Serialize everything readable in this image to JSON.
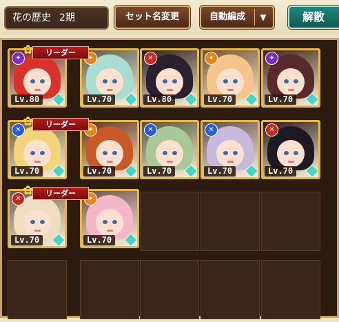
{
  "header": {
    "set_name": "花の歴史",
    "set_period": "2期",
    "rename_label": "セット名変更",
    "auto_label": "自動編成",
    "auto_arrow": "▼",
    "disband_label": "解散"
  },
  "leader_label": "リーダー",
  "rows": [
    {
      "slots": [
        {
          "filled": true,
          "leader": true,
          "element": "purple",
          "level": "Lv.80",
          "hair": "#d8322a"
        },
        {
          "filled": true,
          "leader": false,
          "element": "orange",
          "level": "Lv.70",
          "hair": "#a9ddd2"
        },
        {
          "filled": true,
          "leader": false,
          "element": "red",
          "level": "Lv.80",
          "hair": "#2a2030"
        },
        {
          "filled": true,
          "leader": false,
          "element": "orange",
          "level": "Lv.70",
          "hair": "#f6c48a"
        },
        {
          "filled": true,
          "leader": false,
          "element": "purple",
          "level": "Lv.70",
          "hair": "#5a2a2a"
        }
      ]
    },
    {
      "slots": [
        {
          "filled": true,
          "leader": true,
          "element": "blue",
          "level": "Lv.70",
          "hair": "#f2d47a"
        },
        {
          "filled": true,
          "leader": false,
          "element": "orange",
          "level": "Lv.70",
          "hair": "#c85a28"
        },
        {
          "filled": true,
          "leader": false,
          "element": "blue",
          "level": "Lv.70",
          "hair": "#a8c898"
        },
        {
          "filled": true,
          "leader": false,
          "element": "blue",
          "level": "Lv.70",
          "hair": "#c8b8dc"
        },
        {
          "filled": true,
          "leader": false,
          "element": "red",
          "level": "Lv.70",
          "hair": "#1e1a24"
        }
      ]
    },
    {
      "slots": [
        {
          "filled": true,
          "leader": true,
          "element": "red",
          "level": "Lv.70",
          "hair": "#f0dcc0"
        },
        {
          "filled": true,
          "leader": false,
          "element": "orange",
          "level": "Lv.70",
          "hair": "#f2b8c8"
        },
        {
          "filled": false
        },
        {
          "filled": false
        },
        {
          "filled": false
        }
      ]
    },
    {
      "slots": [
        {
          "filled": false
        },
        {
          "filled": false
        },
        {
          "filled": false
        },
        {
          "filled": false
        },
        {
          "filled": false
        }
      ]
    }
  ],
  "element_colors": {
    "purple": "#7a2fc0",
    "orange": "#e8821a",
    "red": "#c8281e",
    "blue": "#2a5cd8"
  },
  "element_glyphs": {
    "purple": "✦",
    "orange": "✦",
    "red": "✕",
    "blue": "✕"
  }
}
